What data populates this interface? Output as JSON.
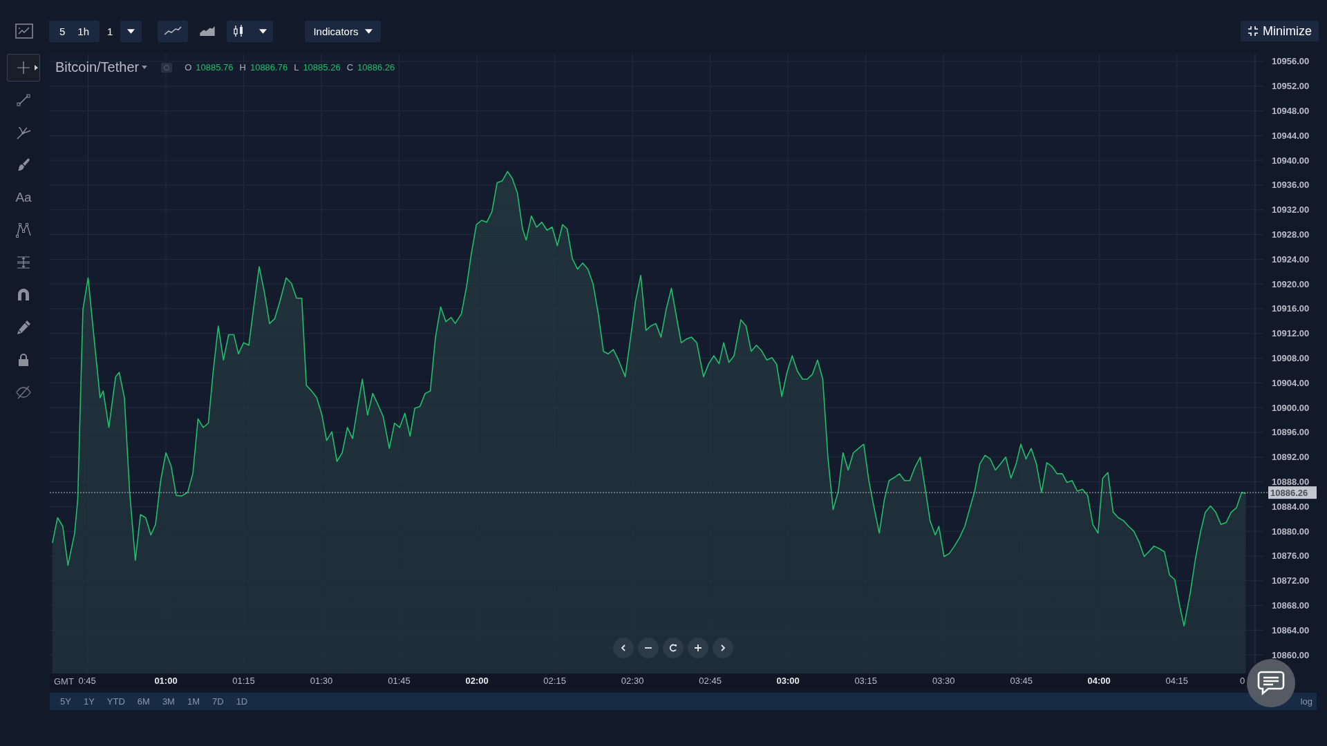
{
  "toolbar": {
    "intervals": [
      {
        "label": "5"
      },
      {
        "label": "1h"
      }
    ],
    "multiplier": "1",
    "chart_types": [
      {
        "kind": "line",
        "selected": false
      },
      {
        "kind": "area",
        "selected": true
      },
      {
        "kind": "candles",
        "selected": false
      }
    ],
    "indicators": "Indicators",
    "minimize": "Minimize"
  },
  "tools": [
    {
      "kind": "crosshair",
      "selected": true
    },
    {
      "kind": "trend-line",
      "selected": false
    },
    {
      "kind": "pitchfork",
      "selected": false
    },
    {
      "kind": "brush",
      "selected": false
    },
    {
      "kind": "text",
      "label": "Aa",
      "selected": false
    },
    {
      "kind": "pattern",
      "selected": false
    },
    {
      "kind": "measure",
      "selected": false
    },
    {
      "kind": "magnet",
      "selected": false
    },
    {
      "kind": "pencil",
      "selected": false
    },
    {
      "kind": "lock",
      "selected": false
    },
    {
      "kind": "hide",
      "selected": false
    }
  ],
  "legend": {
    "ohlc": [
      {
        "key": "O",
        "value": "10885.76"
      },
      {
        "key": "H",
        "value": "10886.76"
      },
      {
        "key": "L",
        "value": "10885.26"
      },
      {
        "key": "C",
        "value": "10886.26"
      }
    ]
  },
  "chart": {
    "time_zone": "GMT",
    "edge_label": "0",
    "chart_data": {
      "type": "area",
      "grid": true,
      "ref_lines": [
        {
          "axis": "y",
          "value": 10886.26,
          "label": "10886.26"
        }
      ],
      "xlim": [
        37.6,
        270.1
      ],
      "ylim": [
        10857,
        10957
      ],
      "xticks": [
        {
          "value": 45,
          "label": "0:45"
        },
        {
          "value": 60,
          "label": "01:00"
        },
        {
          "value": 75,
          "label": "01:15"
        },
        {
          "value": 90,
          "label": "01:30"
        },
        {
          "value": 105,
          "label": "01:45"
        },
        {
          "value": 120,
          "label": "02:00"
        },
        {
          "value": 135,
          "label": "02:15"
        },
        {
          "value": 150,
          "label": "02:30"
        },
        {
          "value": 165,
          "label": "02:45"
        },
        {
          "value": 180,
          "label": "03:00"
        },
        {
          "value": 195,
          "label": "03:15"
        },
        {
          "value": 210,
          "label": "03:30"
        },
        {
          "value": 225,
          "label": "03:45"
        },
        {
          "value": 240,
          "label": "04:00"
        },
        {
          "value": 255,
          "label": "04:15"
        }
      ],
      "yticks": [
        {
          "value": 10860,
          "label": "10860.00"
        },
        {
          "value": 10864,
          "label": "10864.00"
        },
        {
          "value": 10868,
          "label": "10868.00"
        },
        {
          "value": 10872,
          "label": "10872.00"
        },
        {
          "value": 10876,
          "label": "10876.00"
        },
        {
          "value": 10880,
          "label": "10880.00"
        },
        {
          "value": 10884,
          "label": "10884.00"
        },
        {
          "value": 10888,
          "label": "10888.00"
        },
        {
          "value": 10892,
          "label": "10892.00"
        },
        {
          "value": 10896,
          "label": "10896.00"
        },
        {
          "value": 10900,
          "label": "10900.00"
        },
        {
          "value": 10904,
          "label": "10904.00"
        },
        {
          "value": 10908,
          "label": "10908.00"
        },
        {
          "value": 10912,
          "label": "10912.00"
        },
        {
          "value": 10916,
          "label": "10916.00"
        },
        {
          "value": 10920,
          "label": "10920.00"
        },
        {
          "value": 10924,
          "label": "10924.00"
        },
        {
          "value": 10928,
          "label": "10928.00"
        },
        {
          "value": 10932,
          "label": "10932.00"
        },
        {
          "value": 10936,
          "label": "10936.00"
        },
        {
          "value": 10940,
          "label": "10940.00"
        },
        {
          "value": 10944,
          "label": "10944.00"
        },
        {
          "value": 10948,
          "label": "10948.00"
        },
        {
          "value": 10952,
          "label": "10952.00"
        },
        {
          "value": 10956,
          "label": "10956.00"
        }
      ],
      "x": [
        38.1,
        39.1,
        40.1,
        41.1,
        42.4,
        43.0,
        44.0,
        45.0,
        46.0,
        47.3,
        47.9,
        49.0,
        50.3,
        51.0,
        52.0,
        53.0,
        54.1,
        55.1,
        56.1,
        57.1,
        58.0,
        59.0,
        60.0,
        61.0,
        62.0,
        63.0,
        64.2,
        65.2,
        66.2,
        67.2,
        68.2,
        69.1,
        70.1,
        71.1,
        72.1,
        73.1,
        74.0,
        75.0,
        76.0,
        77.0,
        78.0,
        79.0,
        80.0,
        81.0,
        82.0,
        83.2,
        84.2,
        85.2,
        86.2,
        87.1,
        88.1,
        89.1,
        90.1,
        91.0,
        92.0,
        93.0,
        94.0,
        95.0,
        96.0,
        97.0,
        97.9,
        98.9,
        99.9,
        100.9,
        101.9,
        103.1,
        104.1,
        105.1,
        106.1,
        107.1,
        108.0,
        109.0,
        110.0,
        111.0,
        112.0,
        113.0,
        114.0,
        115.0,
        115.8,
        117.0,
        118.0,
        118.9,
        119.9,
        120.9,
        121.9,
        122.9,
        123.9,
        124.9,
        125.9,
        126.8,
        127.8,
        128.8,
        129.5,
        130.5,
        131.5,
        132.5,
        133.5,
        134.5,
        135.5,
        136.5,
        137.4,
        138.4,
        139.4,
        140.4,
        141.4,
        142.4,
        143.4,
        144.4,
        145.3,
        146.3,
        147.3,
        148.6,
        149.6,
        150.6,
        151.6,
        152.6,
        153.5,
        154.5,
        155.5,
        156.5,
        157.5,
        158.5,
        159.4,
        160.4,
        161.4,
        162.4,
        163.7,
        164.7,
        165.7,
        166.7,
        167.6,
        168.6,
        169.6,
        170.9,
        171.9,
        172.9,
        173.9,
        174.9,
        175.9,
        176.9,
        177.8,
        178.8,
        179.8,
        180.8,
        181.8,
        182.8,
        183.7,
        184.7,
        185.7,
        186.7,
        187.7,
        188.7,
        189.7,
        190.6,
        191.6,
        192.6,
        193.6,
        194.6,
        195.6,
        196.6,
        197.6,
        198.6,
        199.5,
        200.5,
        201.5,
        202.5,
        203.5,
        204.5,
        205.5,
        206.4,
        207.4,
        208.4,
        209.1,
        210.1,
        211.1,
        212.1,
        213.1,
        214.1,
        215.1,
        216.0,
        217.0,
        218.0,
        219.0,
        220.0,
        221.0,
        222.0,
        223.0,
        224.0,
        224.9,
        225.9,
        226.9,
        227.9,
        228.9,
        229.9,
        230.9,
        231.9,
        232.9,
        233.8,
        234.8,
        235.8,
        236.8,
        237.8,
        238.8,
        239.8,
        240.7,
        241.7,
        242.7,
        243.7,
        244.7,
        245.7,
        246.7,
        247.7,
        248.7,
        249.6,
        250.6,
        251.6,
        252.6,
        253.6,
        254.6,
        255.6,
        256.4,
        257.6,
        258.6,
        259.6,
        260.5,
        261.5,
        262.5,
        263.5,
        264.5,
        265.5,
        266.5,
        267.5,
        268.3
      ],
      "series": [
        {
          "name": "Bitcoin/Tether",
          "color": "#1fbf6b",
          "values": [
            10878.1,
            10882.2,
            10880.8,
            10874.5,
            10879.7,
            10885.2,
            10915.9,
            10921.0,
            10912.5,
            10901.6,
            10902.7,
            10896.8,
            10905.0,
            10905.7,
            10901.6,
            10886.5,
            10875.3,
            10882.7,
            10882.2,
            10879.4,
            10881.1,
            10888.2,
            10892.7,
            10890.6,
            10885.8,
            10885.7,
            10886.3,
            10889.3,
            10898.2,
            10896.8,
            10897.5,
            10905.7,
            10913.2,
            10907.7,
            10911.8,
            10911.8,
            10908.7,
            10910.5,
            10910.1,
            10916.6,
            10922.8,
            10918.7,
            10913.6,
            10914.4,
            10917.2,
            10921.0,
            10920.1,
            10917.7,
            10917.7,
            10903.6,
            10902.7,
            10901.6,
            10898.8,
            10894.7,
            10896.1,
            10891.3,
            10892.7,
            10896.8,
            10895.0,
            10900.2,
            10904.6,
            10898.8,
            10902.3,
            10900.5,
            10898.6,
            10893.4,
            10897.5,
            10896.8,
            10899.1,
            10895.4,
            10899.9,
            10900.2,
            10902.3,
            10902.7,
            10911.4,
            10916.3,
            10913.9,
            10914.6,
            10913.6,
            10915.2,
            10919.6,
            10924.8,
            10929.6,
            10930.3,
            10930.0,
            10931.7,
            10936.4,
            10936.7,
            10938.2,
            10937.1,
            10934.7,
            10928.9,
            10927.1,
            10931.0,
            10929.2,
            10930.0,
            10928.7,
            10929.2,
            10926.2,
            10929.6,
            10928.9,
            10924.1,
            10922.4,
            10923.4,
            10922.4,
            10920.0,
            10915.2,
            10909.1,
            10908.7,
            10909.4,
            10907.7,
            10905.0,
            10911.1,
            10917.3,
            10921.4,
            10912.5,
            10913.2,
            10913.6,
            10911.4,
            10915.9,
            10919.3,
            10914.6,
            10910.5,
            10911.1,
            10911.4,
            10910.5,
            10905.0,
            10907.1,
            10908.4,
            10907.1,
            10910.5,
            10907.3,
            10908.4,
            10914.2,
            10913.2,
            10909.1,
            10910.1,
            10909.2,
            10907.7,
            10908.1,
            10907.0,
            10901.8,
            10905.7,
            10908.4,
            10905.9,
            10904.6,
            10904.6,
            10905.4,
            10907.7,
            10904.6,
            10892.0,
            10883.5,
            10886.5,
            10892.7,
            10889.9,
            10892.7,
            10893.4,
            10894.1,
            10888.1,
            10883.8,
            10879.7,
            10885.2,
            10888.2,
            10888.7,
            10889.3,
            10888.2,
            10888.2,
            10890.4,
            10892.0,
            10887.2,
            10881.7,
            10879.4,
            10880.8,
            10875.9,
            10876.4,
            10877.6,
            10879.0,
            10880.8,
            10883.8,
            10886.5,
            10890.9,
            10892.3,
            10891.7,
            10889.9,
            10890.9,
            10892.0,
            10888.6,
            10890.9,
            10894.1,
            10891.7,
            10893.4,
            10890.9,
            10886.3,
            10891.1,
            10890.5,
            10889.3,
            10889.3,
            10887.9,
            10888.2,
            10886.5,
            10886.8,
            10885.8,
            10881.1,
            10879.7,
            10888.6,
            10889.5,
            10883.1,
            10882.2,
            10881.7,
            10880.8,
            10880.0,
            10878.3,
            10875.9,
            10876.7,
            10877.6,
            10877.2,
            10876.7,
            10872.9,
            10872.2,
            10867.7,
            10864.7,
            10870.1,
            10875.6,
            10880.0,
            10883.1,
            10884.1,
            10883.1,
            10881.1,
            10881.4,
            10883.1,
            10883.8,
            10886.3,
            10886.1
          ]
        }
      ]
    }
  },
  "ranges": [
    {
      "label": "5Y"
    },
    {
      "label": "1Y"
    },
    {
      "label": "YTD"
    },
    {
      "label": "6M"
    },
    {
      "label": "3M"
    },
    {
      "label": "1M"
    },
    {
      "label": "7D"
    },
    {
      "label": "1D"
    }
  ],
  "scale_mode": "log"
}
